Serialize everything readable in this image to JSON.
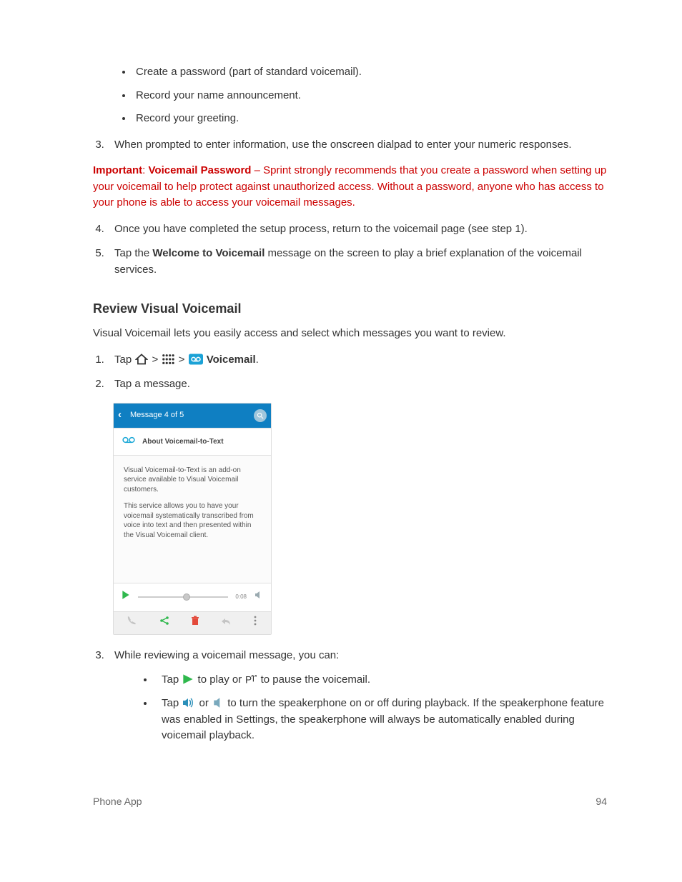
{
  "bullets1": {
    "b1": "Create a password (part of standard voicemail).",
    "b2": "Record your name announcement.",
    "b3": "Record your greeting."
  },
  "step3": "When prompted to enter information, use the onscreen dialpad to enter your numeric responses.",
  "important": {
    "label": "Important",
    "colon": ": ",
    "title": "Voicemail Password",
    "text": " – Sprint strongly recommends that you create a password when setting up your voicemail to help protect against unauthorized access. Without a password, anyone who has access to your phone is able to access your voicemail messages."
  },
  "step4": "Once you have completed the setup process, return to the voicemail page (see step 1).",
  "step5_pre": "Tap the ",
  "step5_bold": "Welcome to Voicemail",
  "step5_post": " message on the screen to play a brief explanation of the voicemail services.",
  "heading": "Review Visual Voicemail",
  "intro": "Visual Voicemail lets you easily access and select which messages you want to review.",
  "rv_step1_tap": "Tap ",
  "rv_step1_gt1": " > ",
  "rv_step1_gt2": " > ",
  "rv_step1_vm": " Voicemail",
  "rv_step1_period": ".",
  "rv_step2": "Tap a message.",
  "screenshot": {
    "header_title": "Message 4 of 5",
    "subheader": "About Voicemail-to-Text",
    "body_p1": "Visual Voicemail-to-Text is an add-on service available to Visual Voicemail customers.",
    "body_p2": "This service allows you to have your voicemail systematically transcribed from voice into text and then presented within the Visual Voicemail client.",
    "time": "0:08"
  },
  "rv_step3": "While reviewing a voicemail message, you can:",
  "rv_sub1_pre": "Tap ",
  "rv_sub1_mid": " to play or ",
  "rv_sub1_post": " to pause the voicemail.",
  "rv_sub2_pre": "Tap ",
  "rv_sub2_or": " or ",
  "rv_sub2_post": " to turn the speakerphone on or off during playback. If the speakerphone feature was enabled in Settings, the speakerphone will always be automatically enabled during voicemail playback.",
  "footer_left": "Phone App",
  "footer_right": "94"
}
